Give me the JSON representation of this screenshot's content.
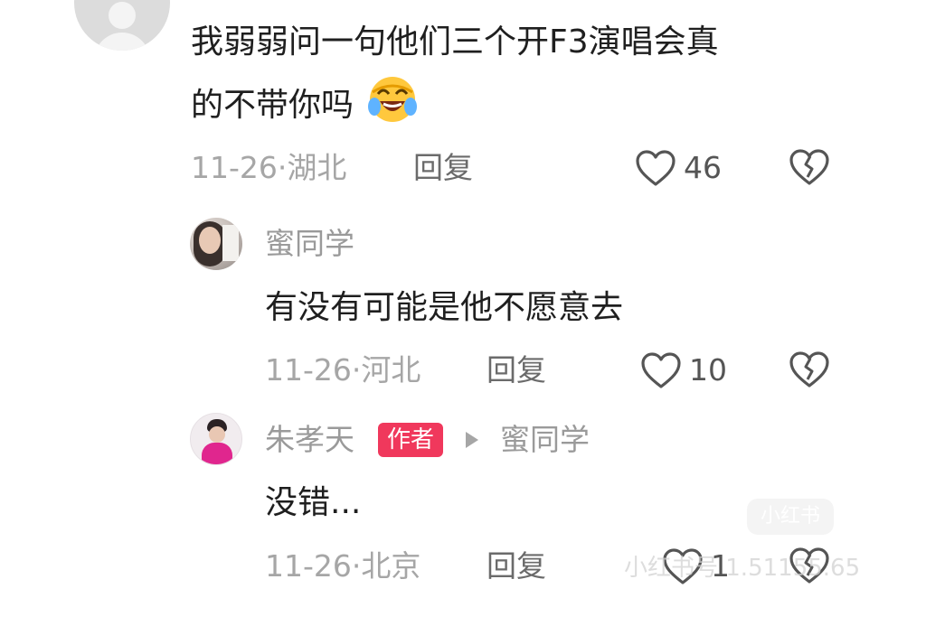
{
  "comments": [
    {
      "text_line1": "我弱弱问一句他们三个开F3演唱会真",
      "text_line2": "的不带你吗",
      "emoji": "laughing-crying-face-icon",
      "date": "11-26·",
      "location": "湖北",
      "reply_label": "回复",
      "likes": "46"
    },
    {
      "username": "蜜同学",
      "text": "有没有可能是他不愿意去",
      "date": "11-26·",
      "location": "河北",
      "reply_label": "回复",
      "likes": "10"
    },
    {
      "username": "朱孝天",
      "badge": "作者",
      "reply_to": "蜜同学",
      "text": "没错...",
      "date": "11-26·",
      "location": "北京",
      "reply_label": "回复",
      "likes": "1"
    }
  ],
  "watermark": {
    "logo_text": "小红书",
    "text": "小红书号 1.51155.65"
  },
  "colors": {
    "badge": "#f0385c",
    "meta_text": "#a6a6a6",
    "body_text": "#1f1f1f"
  }
}
